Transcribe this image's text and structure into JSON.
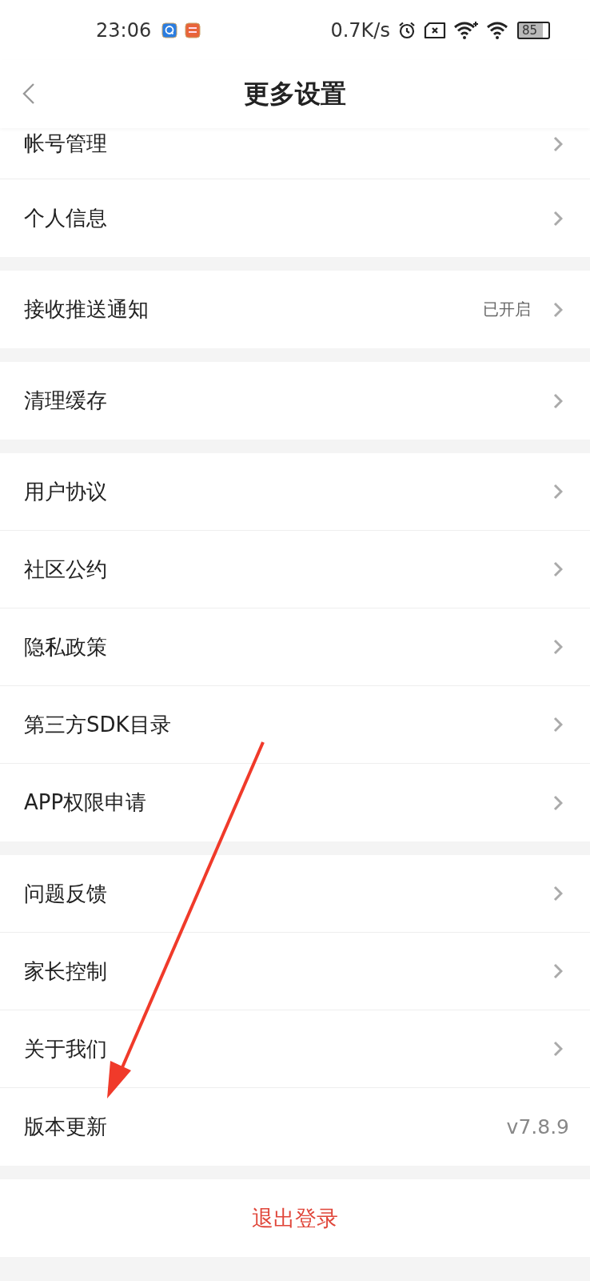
{
  "status_bar": {
    "time": "23:06",
    "speed": "0.7K/s",
    "battery": "85"
  },
  "header": {
    "title": "更多设置"
  },
  "groups": [
    {
      "rows": [
        {
          "label": "帐号管理",
          "kind": "link",
          "cut": true
        },
        {
          "label": "个人信息",
          "kind": "link"
        }
      ]
    },
    {
      "rows": [
        {
          "label": "接收推送通知",
          "value": "已开启",
          "kind": "link"
        }
      ]
    },
    {
      "rows": [
        {
          "label": "清理缓存",
          "kind": "link"
        }
      ]
    },
    {
      "rows": [
        {
          "label": "用户协议",
          "kind": "link"
        },
        {
          "label": "社区公约",
          "kind": "link"
        },
        {
          "label": "隐私政策",
          "kind": "link"
        },
        {
          "label": "第三方SDK目录",
          "kind": "link"
        },
        {
          "label": "APP权限申请",
          "kind": "link"
        }
      ]
    },
    {
      "rows": [
        {
          "label": "问题反馈",
          "kind": "link"
        },
        {
          "label": "家长控制",
          "kind": "link"
        },
        {
          "label": "关于我们",
          "kind": "link"
        },
        {
          "label": "版本更新",
          "value": "v7.8.9",
          "kind": "info"
        }
      ]
    }
  ],
  "logout": {
    "label": "退出登录"
  }
}
